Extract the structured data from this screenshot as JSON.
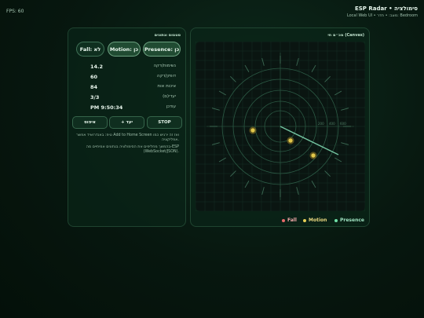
{
  "header": {
    "fps": "FPS: 60",
    "title": "ESP Radar • סימולציה",
    "subtitle": "Local Web UI • מצב: • חדר: Bedroom"
  },
  "status": {
    "title": "סטטוס ונתונים",
    "pills": {
      "presence": "Presence: כן",
      "motion": "Motion: כן",
      "fall": "Fall: לא"
    },
    "rows": [
      {
        "label": "נשימות/דקה",
        "value": "14.2"
      },
      {
        "label": "דופק/דקה",
        "value": "60"
      },
      {
        "label": "איכות אות",
        "value": "84"
      },
      {
        "label": "יעדי(ם)",
        "value": "3/3"
      },
      {
        "label": "עודכן",
        "value": "PM 9:50:34"
      }
    ],
    "buttons": {
      "stop": "STOP",
      "export": "+ יעד",
      "reset": "איפוס"
    },
    "tips": [
      "טיפ: באנדרואיד אפשר Add to Home Screen ואז זה ירגיש כמו אפליקציה.",
      "בהמשך מחליפים את הסימולציה בנתונים אמיתיים מה-ESP (WebSocket/JSON)."
    ]
  },
  "radar": {
    "title": "מכ״ם חי (Canvas)",
    "legend": {
      "presence": "Presence",
      "motion": "Motion",
      "fall": "Fall"
    },
    "ring_labels": [
      "200",
      "400",
      "600"
    ],
    "colors": {
      "grid": "#1f4433",
      "ring": "#2c5a45",
      "sweep": "#7fd6b0",
      "target_fill": "#e2c74a",
      "target_halo": "#7a6a22",
      "presence_dot": "#6fe0a8",
      "motion_dot": "#e8cf55",
      "fall_dot": "#e86a6a"
    }
  }
}
